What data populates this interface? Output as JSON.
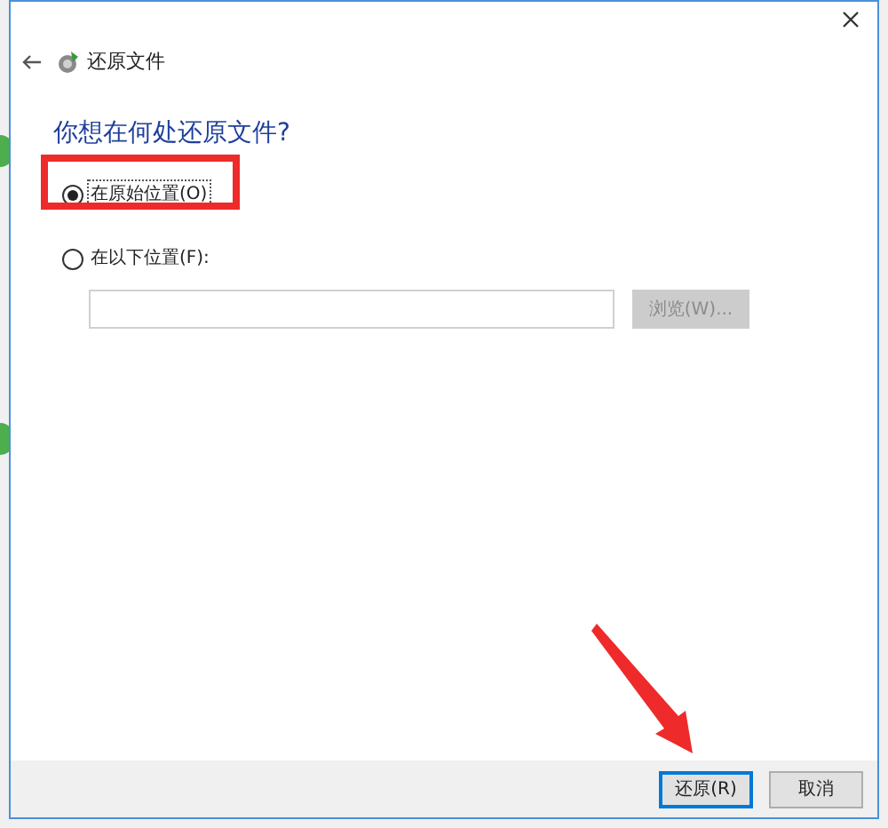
{
  "window": {
    "title": "还原文件"
  },
  "heading": "你想在何处还原文件?",
  "options": [
    {
      "label": "在原始位置(O)",
      "selected": true,
      "focused": true
    },
    {
      "label": "在以下位置(F):",
      "selected": false,
      "focused": false
    }
  ],
  "browse_button": {
    "label": "浏览(W)...",
    "disabled": true
  },
  "buttons": [
    {
      "label": "还原(R)",
      "default": true
    },
    {
      "label": "取消",
      "default": false
    }
  ]
}
